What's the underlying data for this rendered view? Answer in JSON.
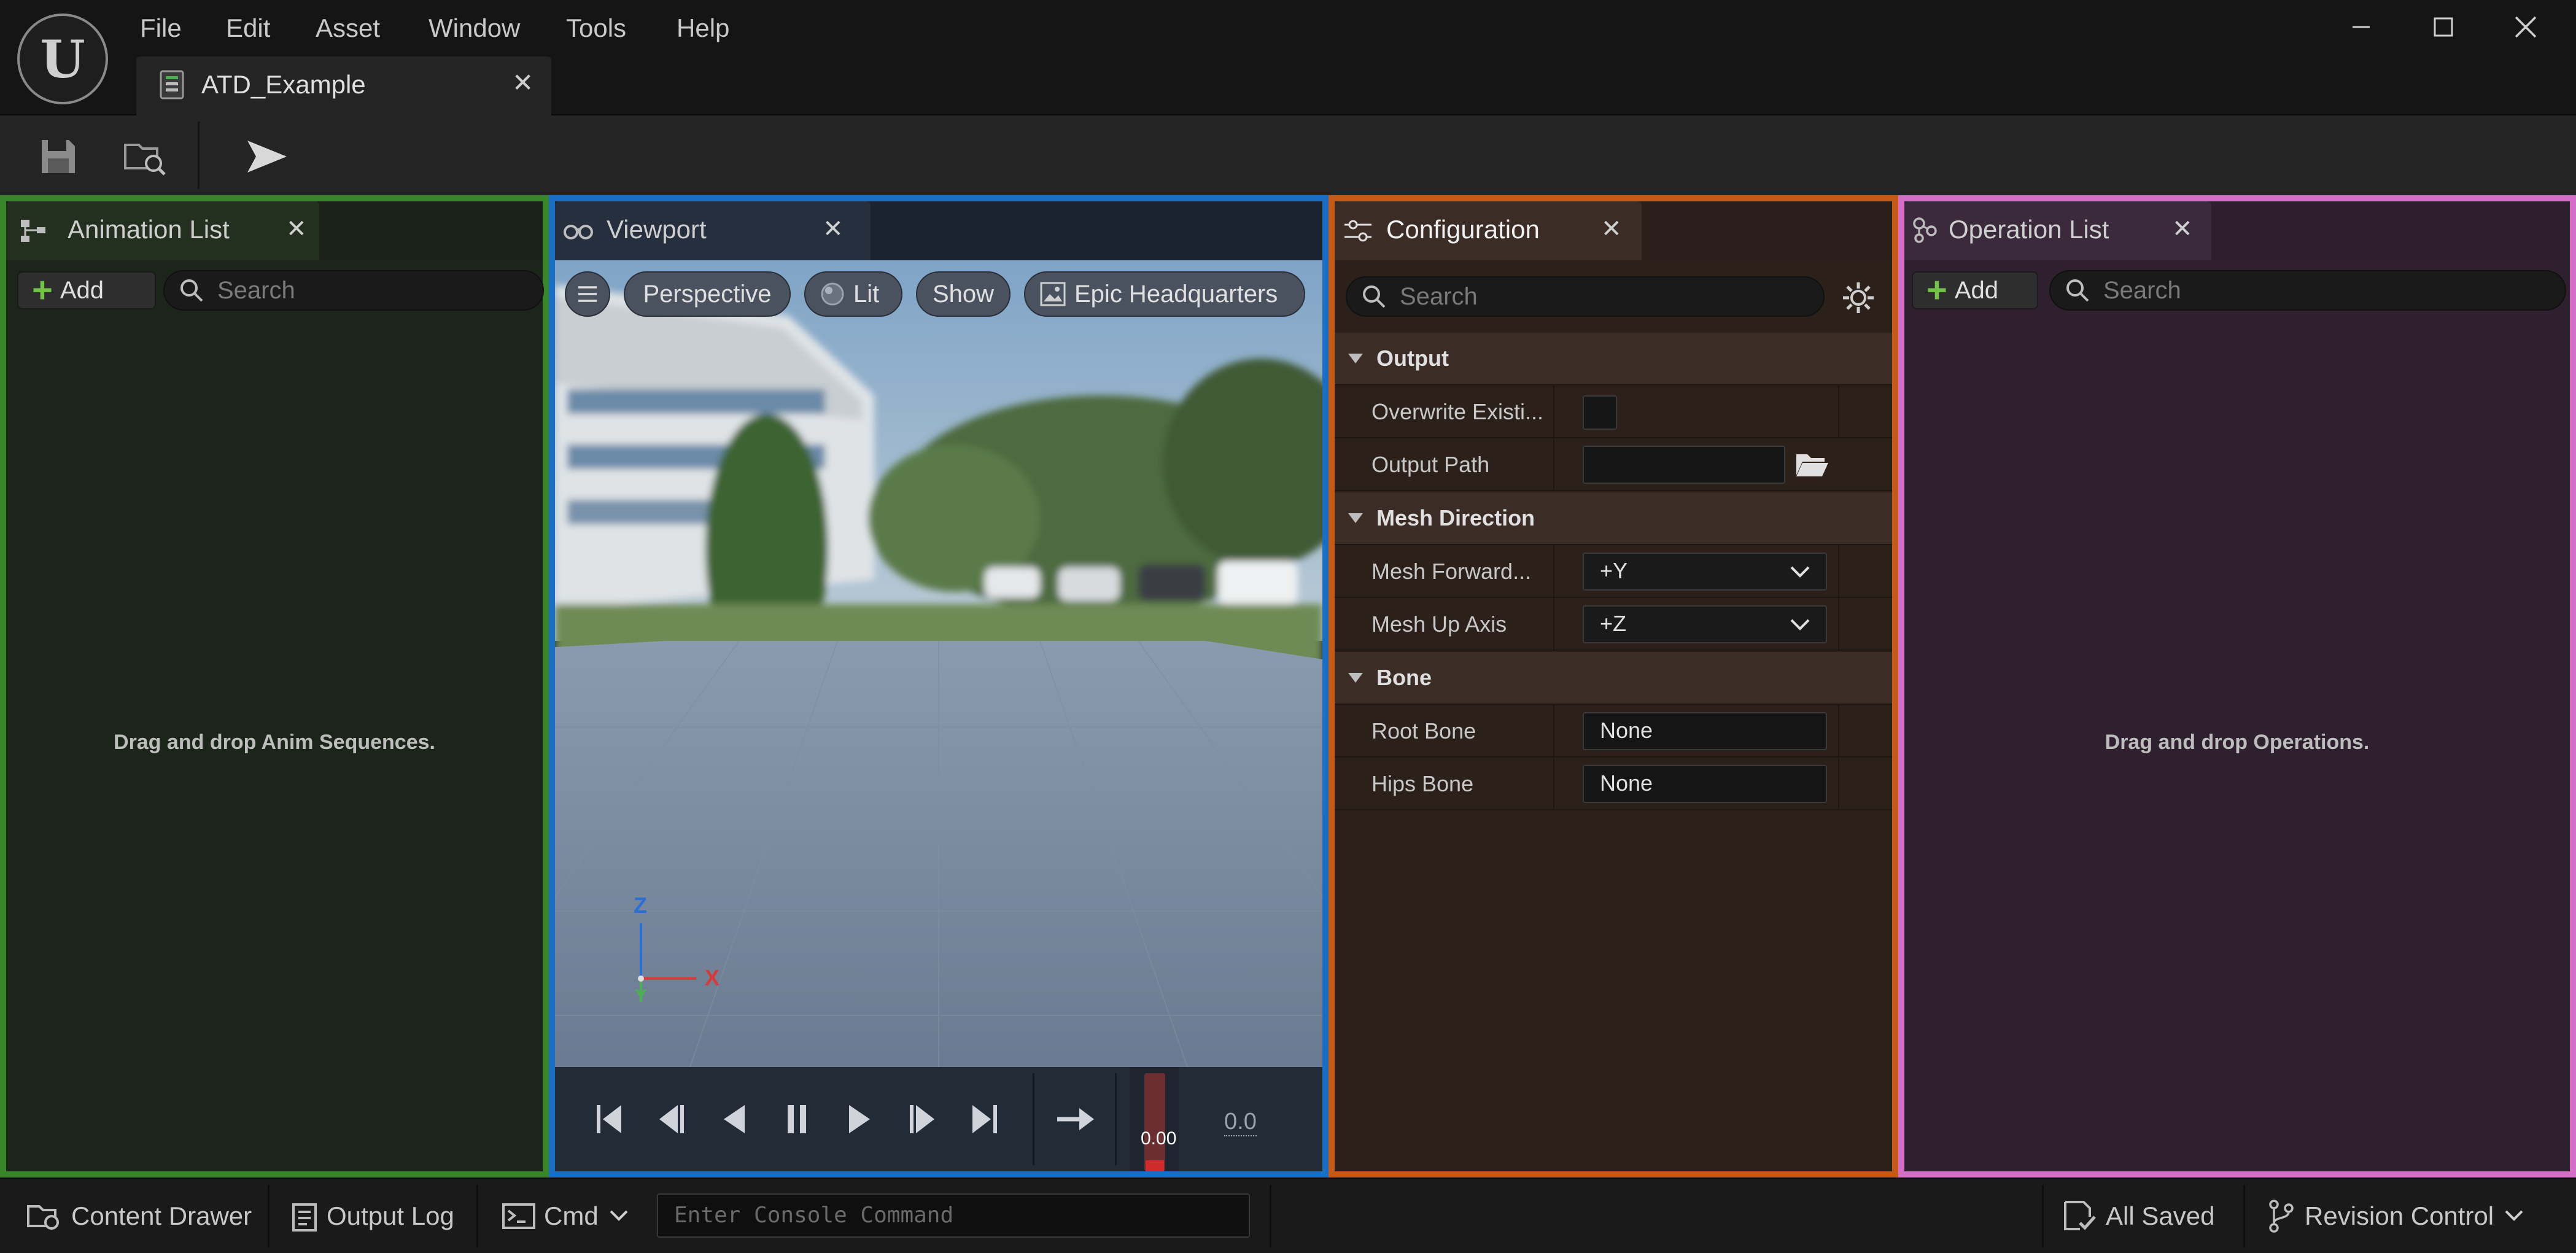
{
  "menu": [
    "File",
    "Edit",
    "Asset",
    "Window",
    "Tools",
    "Help"
  ],
  "document_tab": "ATD_Example",
  "panels": {
    "animation_list": {
      "title": "Animation List",
      "add_label": "Add",
      "search_placeholder": "Search",
      "empty_message": "Drag and drop Anim Sequences.",
      "frame_color": "#39852a"
    },
    "viewport": {
      "title": "Viewport",
      "perspective_label": "Perspective",
      "lit_label": "Lit",
      "show_label": "Show",
      "environment_label": "Epic Headquarters",
      "axis_z": "Z",
      "axis_x": "X",
      "axis_y": "Y",
      "time_display": "0.00",
      "time_value": "0.0",
      "frame_color": "#1a6fc4"
    },
    "configuration": {
      "title": "Configuration",
      "search_placeholder": "Search",
      "frame_color": "#c55a16",
      "sections": {
        "output": {
          "label": "Output",
          "overwrite_label": "Overwrite Existi...",
          "overwrite_checked": false,
          "output_path_label": "Output Path",
          "output_path_value": ""
        },
        "mesh_direction": {
          "label": "Mesh Direction",
          "forward_label": "Mesh Forward...",
          "forward_value": "+Y",
          "up_label": "Mesh Up Axis",
          "up_value": "+Z"
        },
        "bone": {
          "label": "Bone",
          "root_label": "Root Bone",
          "root_value": "None",
          "hips_label": "Hips Bone",
          "hips_value": "None"
        }
      }
    },
    "operation_list": {
      "title": "Operation List",
      "add_label": "Add",
      "search_placeholder": "Search",
      "empty_message": "Drag and drop Operations.",
      "frame_color": "#d46ec6"
    }
  },
  "statusbar": {
    "content_drawer": "Content Drawer",
    "output_log": "Output Log",
    "cmd": "Cmd",
    "console_placeholder": "Enter Console Command",
    "all_saved": "All Saved",
    "revision_control": "Revision Control"
  }
}
